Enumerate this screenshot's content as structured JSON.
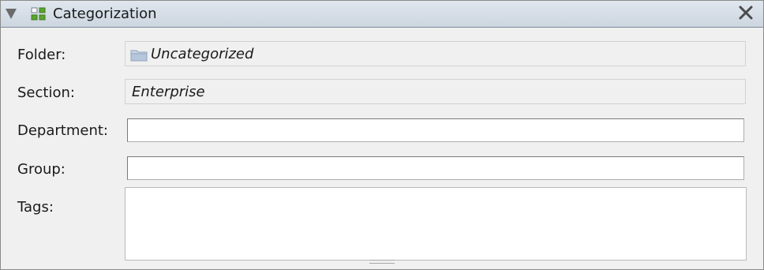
{
  "panel": {
    "title": "Categorization",
    "icons": {
      "collapse": "collapse-triangle-icon",
      "category": "category-grid-icon",
      "close": "close-icon",
      "folder": "folder-icon"
    }
  },
  "fields": {
    "folder": {
      "label": "Folder:",
      "value": "Uncategorized"
    },
    "section": {
      "label": "Section:",
      "value": "Enterprise"
    },
    "department": {
      "label": "Department:",
      "value": ""
    },
    "group": {
      "label": "Group:",
      "value": ""
    },
    "tags": {
      "label": "Tags:",
      "value": ""
    }
  },
  "colors": {
    "header_bg": "#d7dee7",
    "grid_icon_green": "#5aa52c",
    "folder_icon": "#aebfd4"
  }
}
